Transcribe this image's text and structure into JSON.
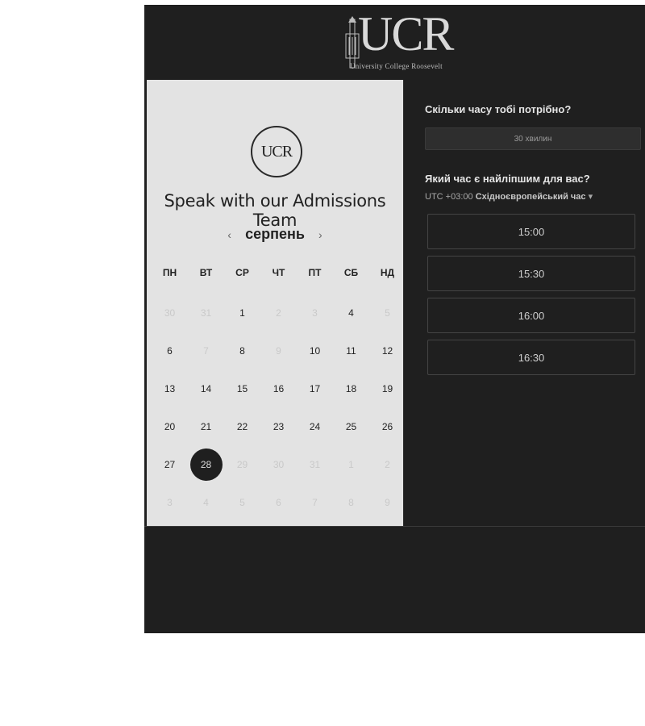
{
  "header": {
    "logo_text": "UCR",
    "logo_subtitle": "University College Roosevelt"
  },
  "left": {
    "badge_text": "UCR",
    "title": "Speak with our Admissions Team",
    "prev_icon": "chevron-left-icon",
    "month": "серпень",
    "next_icon": "chevron-right-icon",
    "weekdays": [
      "ПН",
      "ВТ",
      "СР",
      "ЧТ",
      "ПТ",
      "СБ",
      "НД"
    ],
    "days": [
      {
        "d": "30",
        "m": true
      },
      {
        "d": "31",
        "m": true
      },
      {
        "d": "1",
        "m": false
      },
      {
        "d": "2",
        "m": true
      },
      {
        "d": "3",
        "m": true
      },
      {
        "d": "4",
        "m": false
      },
      {
        "d": "5",
        "m": true
      },
      {
        "d": "6",
        "m": false
      },
      {
        "d": "7",
        "m": true
      },
      {
        "d": "8",
        "m": false
      },
      {
        "d": "9",
        "m": true
      },
      {
        "d": "10",
        "m": false
      },
      {
        "d": "11",
        "m": false
      },
      {
        "d": "12",
        "m": false
      },
      {
        "d": "13",
        "m": false
      },
      {
        "d": "14",
        "m": false
      },
      {
        "d": "15",
        "m": false
      },
      {
        "d": "16",
        "m": false
      },
      {
        "d": "17",
        "m": false
      },
      {
        "d": "18",
        "m": false
      },
      {
        "d": "19",
        "m": false
      },
      {
        "d": "20",
        "m": false
      },
      {
        "d": "21",
        "m": false
      },
      {
        "d": "22",
        "m": false
      },
      {
        "d": "23",
        "m": false
      },
      {
        "d": "24",
        "m": false
      },
      {
        "d": "25",
        "m": false
      },
      {
        "d": "26",
        "m": false
      },
      {
        "d": "27",
        "m": false
      },
      {
        "d": "28",
        "m": false,
        "sel": true
      },
      {
        "d": "29",
        "m": true
      },
      {
        "d": "30",
        "m": true
      },
      {
        "d": "31",
        "m": true
      },
      {
        "d": "1",
        "m": true
      },
      {
        "d": "2",
        "m": true
      },
      {
        "d": "3",
        "m": true
      },
      {
        "d": "4",
        "m": true
      },
      {
        "d": "5",
        "m": true
      },
      {
        "d": "6",
        "m": true
      },
      {
        "d": "7",
        "m": true
      },
      {
        "d": "8",
        "m": true
      },
      {
        "d": "9",
        "m": true
      }
    ]
  },
  "right": {
    "duration_question": "Скільки часу тобі потрібно?",
    "duration_value": "30 хвилин",
    "time_question": "Який час є найліпшим для вас?",
    "tz_offset": "UTC +03:00",
    "tz_name": "Східноєвропейський час",
    "tz_dropdown_icon": "caret-down-icon",
    "slots": [
      "15:00",
      "15:30",
      "16:00",
      "16:30"
    ]
  },
  "colors": {
    "dark_bg": "#1f1f1f",
    "calendar_bg": "#e3e3e3",
    "selected_day": "#1f1f1f"
  }
}
